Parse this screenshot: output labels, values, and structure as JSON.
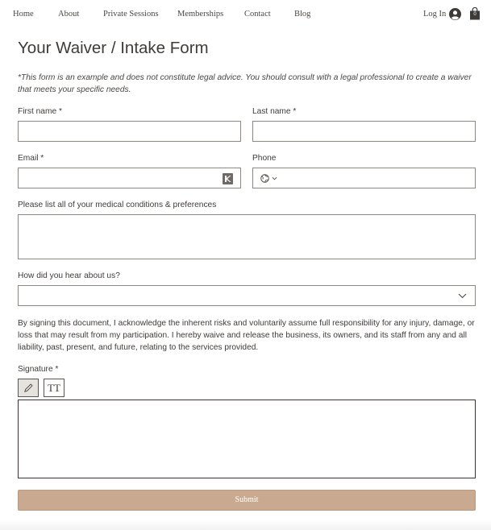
{
  "nav": {
    "items": [
      "Home",
      "About",
      "Private Sessions",
      "Memberships",
      "Contact",
      "Blog"
    ],
    "login_label": "Log In",
    "cart_count": "0"
  },
  "form": {
    "title": "Your Waiver / Intake Form",
    "disclaimer": "*This form is an example and does not constitute legal advice. You should consult with a legal professional to create a waiver that meets your specific needs.",
    "first_name_label": "First name *",
    "first_name_value": "",
    "last_name_label": "Last name *",
    "last_name_value": "",
    "email_label": "Email *",
    "email_value": "",
    "phone_label": "Phone",
    "phone_value": "",
    "medical_label": "Please list all of your medical conditions & preferences",
    "medical_value": "",
    "referral_label": "How did you hear about us?",
    "referral_selected": "",
    "consent_text": "By signing this document, I acknowledge the inherent risks and voluntarily assume full responsibility for any injury, damage, or loss that may result from my participation. I hereby waive and release the business, its owners, and its staff from any and all liability, past, present, and future, relating to the services provided.",
    "signature_label": "Signature *",
    "signature_text_tool": "TT",
    "submit_label": "Submit"
  },
  "colors": {
    "submit_bg": "#c9a990",
    "text": "#3f3b38",
    "field_border": "#8d8781",
    "signature_border": "#3d3330"
  },
  "icons": {
    "user": "avatar-icon",
    "cart": "shopping-bag-icon",
    "email_autofill": "autofill-icon",
    "phone_country": "globe-icon",
    "select": "chevron-down-icon",
    "draw": "pencil-icon",
    "type": "text-type-icon"
  }
}
